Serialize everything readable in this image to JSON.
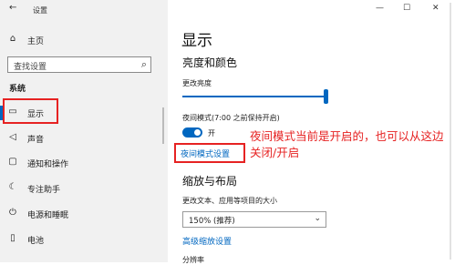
{
  "window": {
    "title": "设置",
    "controls": [
      "—",
      "☐",
      "✕"
    ]
  },
  "sidebar": {
    "home": "主页",
    "search_placeholder": "查找设置",
    "section": "系统",
    "items": [
      {
        "icon": "monitor-icon",
        "label": "显示",
        "active": true
      },
      {
        "icon": "speaker-icon",
        "label": "声音"
      },
      {
        "icon": "notification-icon",
        "label": "通知和操作"
      },
      {
        "icon": "moon-icon",
        "label": "专注助手"
      },
      {
        "icon": "power-icon",
        "label": "电源和睡眠"
      },
      {
        "icon": "battery-icon",
        "label": "电池"
      }
    ]
  },
  "main": {
    "title": "显示",
    "section_brightness": "亮度和颜色",
    "brightness_label": "更改亮度",
    "brightness_level": 0.98,
    "night_light_label": "夜间模式(7:00 之前保持开启)",
    "toggle_state": "开",
    "night_light_settings_link": "夜间模式设置",
    "annotation": "夜间模式当前是开启的，也可以从这边关闭/开启",
    "section_scale": "缩放与布局",
    "scale_label": "更改文本、应用等项目的大小",
    "scale_value": "150% (推荐)",
    "advanced_scaling_link": "高级缩放设置",
    "resolution_label": "分辨率"
  },
  "colors": {
    "accent": "#0067c0",
    "annotation": "#e62222"
  }
}
